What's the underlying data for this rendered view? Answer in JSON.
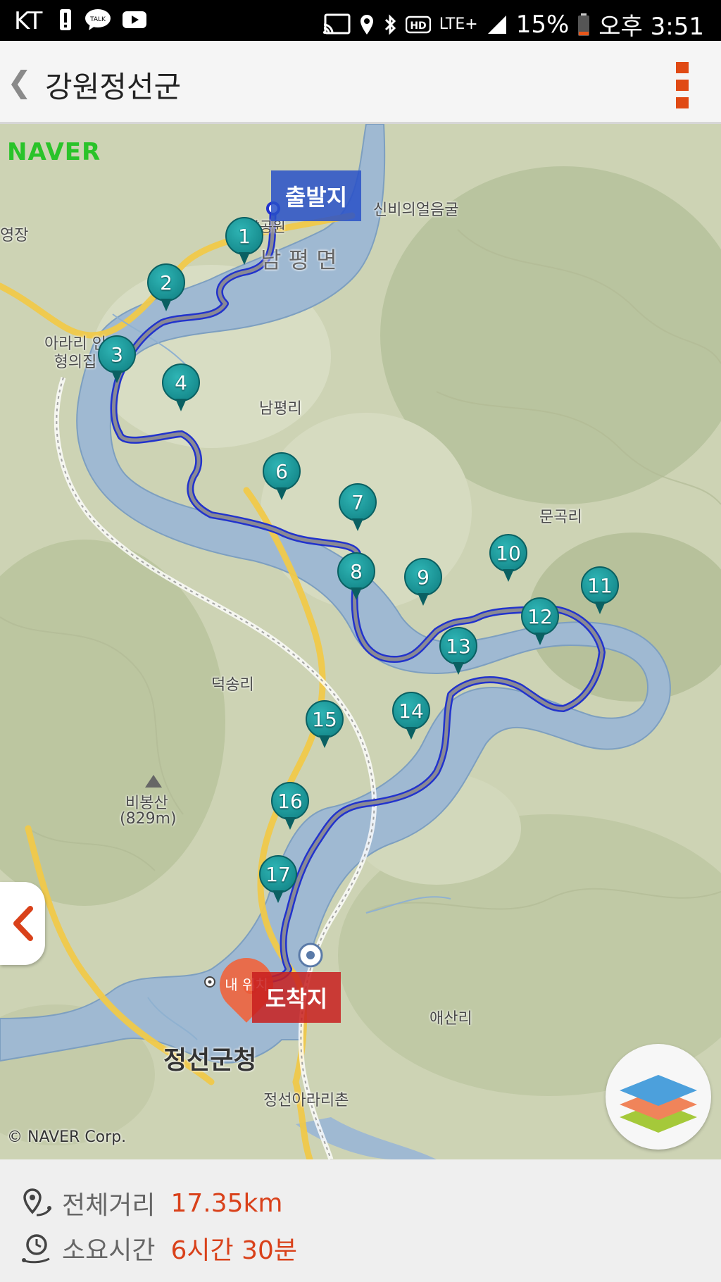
{
  "status_bar": {
    "carrier": "KT",
    "battery": "15%",
    "time": "오후 3:51",
    "network": "LTE+"
  },
  "app_bar": {
    "title": "강원정선군"
  },
  "map": {
    "brand": "NAVER",
    "copyright": "© NAVER Corp.",
    "start_label": "출발지",
    "end_label": "도착지",
    "my_location_label": "내 위치",
    "place_labels": {
      "cave": "신비의얼음굴",
      "nampyeong_myeon": "남 평 면",
      "nanghyang": "난향공원",
      "yeongjang": "영장",
      "arari": "아라리 인형의집",
      "nampyeongri": "남평리",
      "mungokri": "문곡리",
      "deoksongri": "덕송리",
      "bibongsan": "비봉산",
      "bibongsan_height": "(829m)",
      "aesanri": "애산리",
      "county_office": "정선군청",
      "arari_village": "정선아라리촌"
    },
    "waypoints": [
      "1",
      "2",
      "3",
      "4",
      "6",
      "7",
      "8",
      "9",
      "10",
      "11",
      "12",
      "13",
      "14",
      "15",
      "16",
      "17"
    ]
  },
  "route_info": {
    "distance_label": "전체거리",
    "distance_value": "17.35km",
    "duration_label": "소요시간",
    "duration_value": "6시간 30분"
  },
  "colors": {
    "accent": "#e04a14",
    "value_red": "#d9411a",
    "marker_teal": "#0e7d80",
    "route_line": "#2233cc"
  }
}
